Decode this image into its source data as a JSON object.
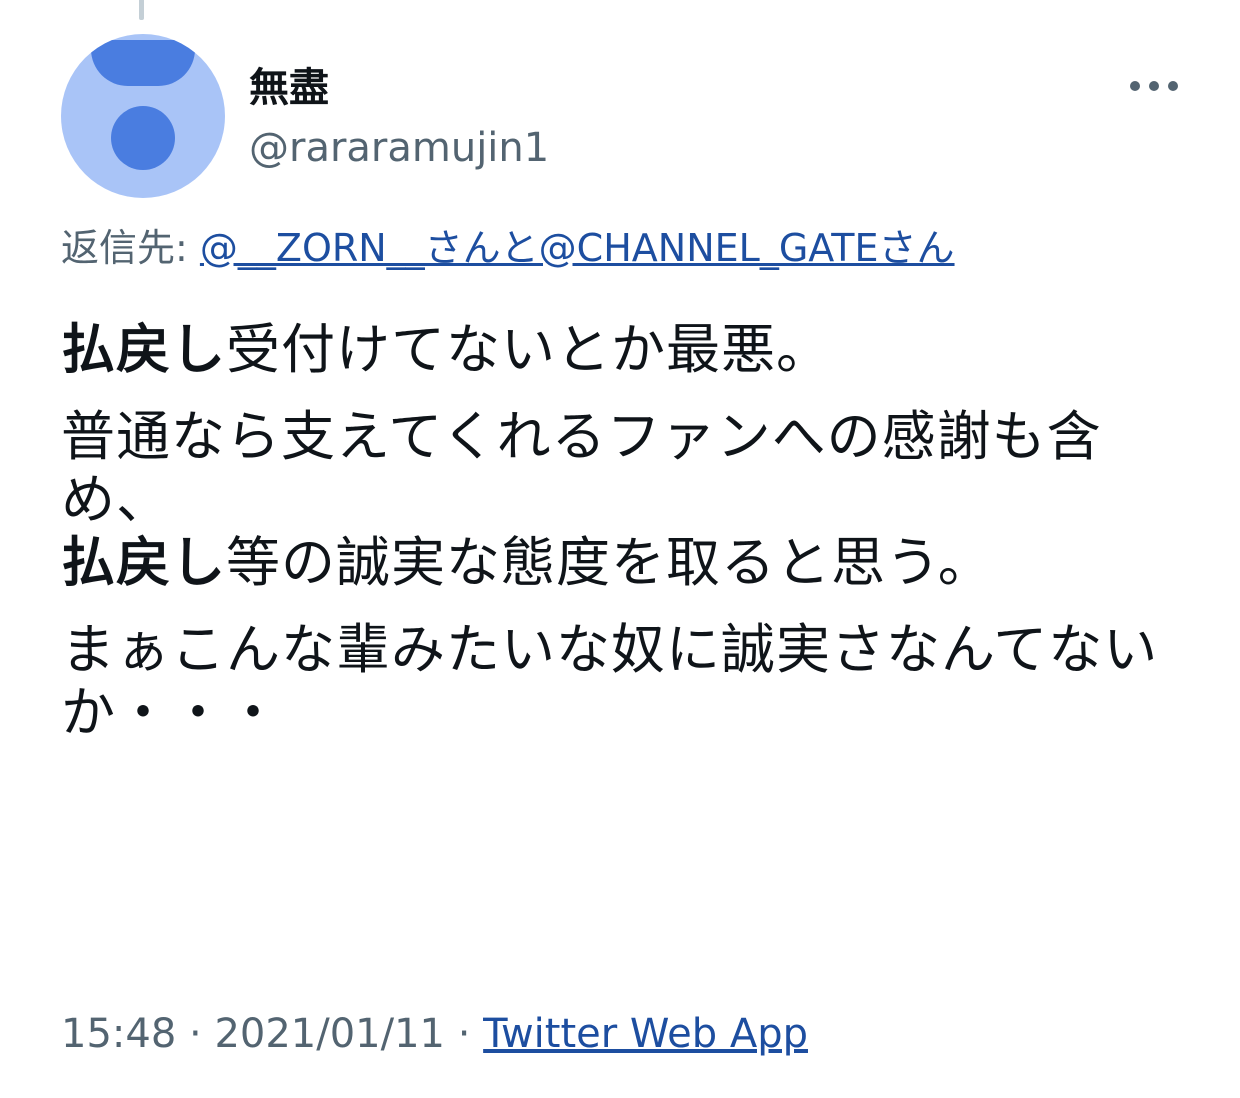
{
  "author": {
    "display_name": "無盡",
    "handle": "@rararamujin1"
  },
  "reply": {
    "prefix": "返信先:",
    "link_text": "@__ZORN__さんと@CHANNEL_GATEさん"
  },
  "tweet": {
    "p1_bold": "払戻し",
    "p1_rest": "受付けてないとか最悪。",
    "p2_line1": "普通なら支えてくれるファンへの感謝も含め、",
    "p2_bold": "払戻し",
    "p2_rest": "等の誠実な態度を取ると思う。",
    "p3": "まぁこんな輩みたいな奴に誠実さなんてないか・・・"
  },
  "meta": {
    "time": "15:48",
    "sep1": " · ",
    "date": "2021/01/11",
    "sep2": " · ",
    "source": "Twitter Web App"
  },
  "icons": {
    "avatar": "default-avatar-icon",
    "more": "more-options-icon"
  },
  "colors": {
    "link": "#1d4ea0",
    "secondary_text": "#536471",
    "avatar_bg": "#a9c4f7",
    "avatar_fg": "#4a7de0"
  }
}
